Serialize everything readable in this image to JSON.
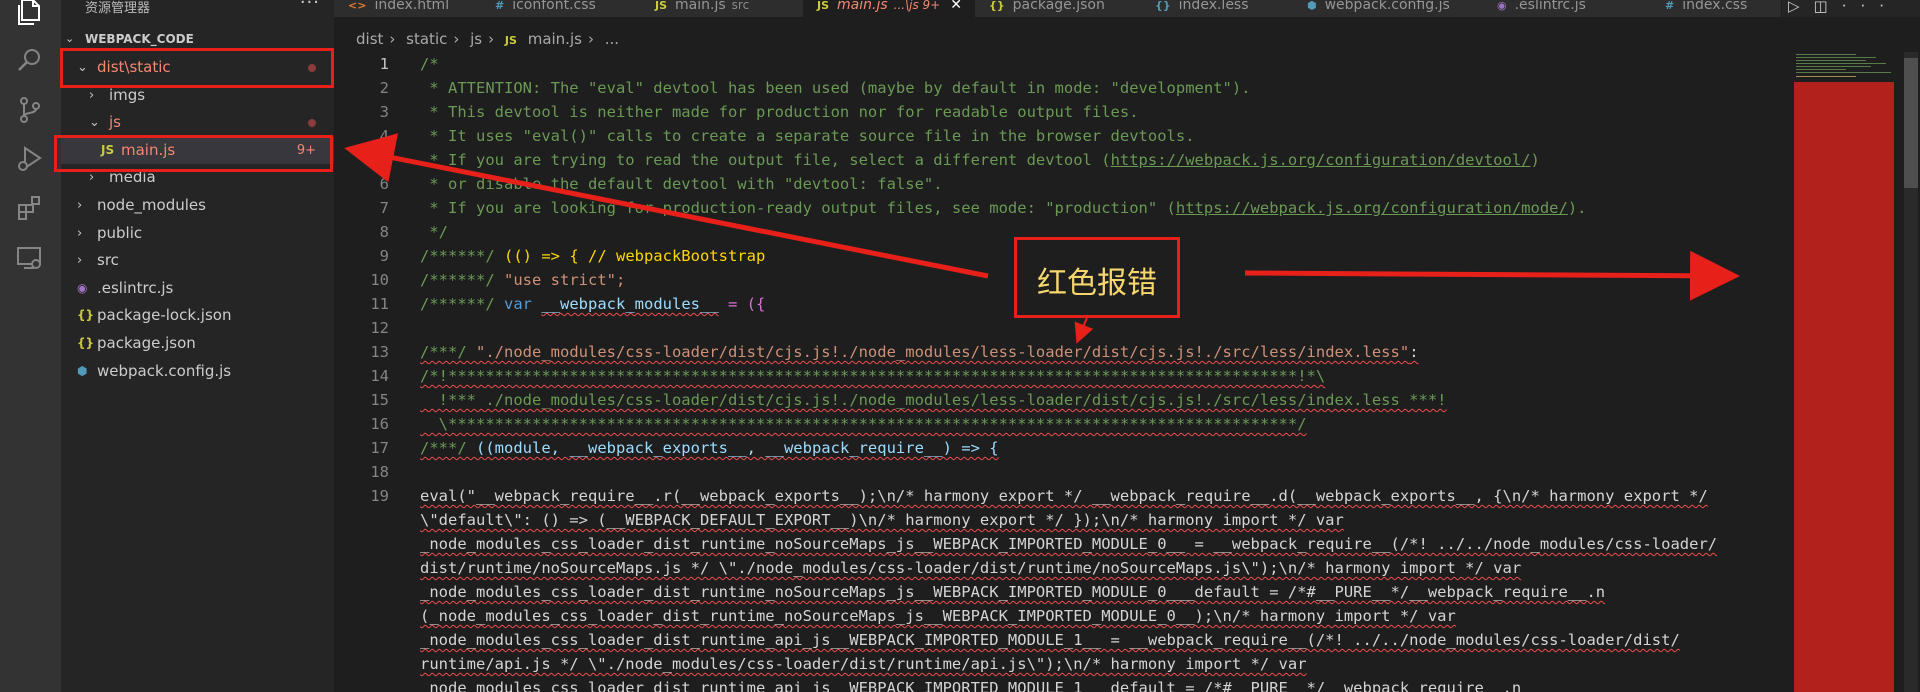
{
  "activity_bar": {
    "icons": [
      "explorer-icon",
      "search-icon",
      "source-control-icon",
      "run-debug-icon",
      "extensions-icon",
      "remote-explorer-icon"
    ]
  },
  "sidebar": {
    "title": "资源管理器",
    "more": "···",
    "section": "WEBPACK_CODE",
    "tree": [
      {
        "name": "dist\\static",
        "type": "folder",
        "expanded": true,
        "indent": 0,
        "dot": true
      },
      {
        "name": "imgs",
        "type": "folder",
        "expanded": false,
        "indent": 1
      },
      {
        "name": "js",
        "type": "folder",
        "expanded": true,
        "indent": 1,
        "dot": true
      },
      {
        "name": "main.js",
        "type": "js",
        "indent": 2,
        "badge": "9+",
        "selected": true
      },
      {
        "name": "media",
        "type": "folder",
        "expanded": false,
        "indent": 1
      },
      {
        "name": "node_modules",
        "type": "folder",
        "expanded": false,
        "indent": 0
      },
      {
        "name": "public",
        "type": "folder",
        "expanded": false,
        "indent": 0
      },
      {
        "name": "src",
        "type": "folder",
        "expanded": false,
        "indent": 0
      },
      {
        "name": ".eslintrc.js",
        "type": "eslint",
        "indent": 0
      },
      {
        "name": "package-lock.json",
        "type": "json",
        "indent": 0
      },
      {
        "name": "package.json",
        "type": "json",
        "indent": 0
      },
      {
        "name": "webpack.config.js",
        "type": "webpack",
        "indent": 0
      }
    ]
  },
  "tabs": [
    {
      "icon": "<>",
      "label": "index.html",
      "color": "#e37933"
    },
    {
      "icon": "#",
      "label": "iconfont.css",
      "color": "#519aba"
    },
    {
      "icon": "JS",
      "label": "main.js",
      "sub": "src",
      "color": "#cbcb41"
    },
    {
      "icon": "JS",
      "label": "main.js",
      "sub": "...\\js 9+",
      "color": "#cbcb41",
      "active": true
    },
    {
      "icon": "{}",
      "label": "package.json",
      "color": "#cbcb41"
    },
    {
      "icon": "{}",
      "label": "index.less",
      "color": "#519aba"
    },
    {
      "icon": "⬢",
      "label": "webpack.config.js",
      "color": "#519aba"
    },
    {
      "icon": "◉",
      "label": ".eslintrc.js",
      "color": "#a074c4"
    },
    {
      "icon": "#",
      "label": "index.css",
      "color": "#519aba"
    }
  ],
  "tab_actions": [
    "▷",
    "◫",
    "···"
  ],
  "breadcrumb": [
    "dist",
    "static",
    "js",
    "JS",
    "main.js",
    "..."
  ],
  "editor": {
    "line_numbers": [
      "1",
      "2",
      "3",
      "4",
      "5",
      "6",
      "7",
      "8",
      "9",
      "10",
      "11",
      "12",
      "13",
      "14",
      "15",
      "16",
      "17",
      "18",
      "19"
    ],
    "lines": [
      "/*",
      " * ATTENTION: The \"eval\" devtool has been used (maybe by default in mode: \"development\").",
      " * This devtool is neither made for production nor for readable output files.",
      " * It uses \"eval()\" calls to create a separate source file in the browser devtools.",
      " * If you are trying to read the output file, select a different devtool (",
      " * or disable the default devtool with \"devtool: false\".",
      " * If you are looking for production-ready output files, see mode: \"production\" (",
      " */",
      "/******/ ",
      "/******/ ",
      "/******/ ",
      "",
      "/***/ ",
      "/*!*******************************************************************************************!*\\",
      "  !*** ./node_modules/css-loader/dist/cjs.js!./node_modules/less-loader/dist/cjs.js!./src/less/index.less ***!",
      "  \\*******************************************************************************************/",
      "/***/ ",
      "",
      "eval(\"__webpack_require__.r(__webpack_exports__);\\n/* harmony export */ __webpack_require__.d(__webpack_exports__, {\\n/* harmony export */",
      "\\\"default\\\": () => (__WEBPACK_DEFAULT_EXPORT__)\\n/* harmony export */ });\\n/* harmony import */ var",
      "_node_modules_css_loader_dist_runtime_noSourceMaps_js__WEBPACK_IMPORTED_MODULE_0__ = __webpack_require__(/*! ../../node_modules/css-loader/",
      "dist/runtime/noSourceMaps.js */ \\\"./node_modules/css-loader/dist/runtime/noSourceMaps.js\\\");\\n/* harmony import */ var",
      "_node_modules_css_loader_dist_runtime_noSourceMaps_js__WEBPACK_IMPORTED_MODULE_0___default = /*#__PURE__*/__webpack_require__.n",
      "(_node_modules_css_loader_dist_runtime_noSourceMaps_js__WEBPACK_IMPORTED_MODULE_0__);\\n/* harmony import */ var",
      "_node_modules_css_loader_dist_runtime_api_js__WEBPACK_IMPORTED_MODULE_1__ = __webpack_require__(/*! ../../node_modules/css-loader/dist/",
      "runtime/api.js */ \\\"./node_modules/css-loader/dist/runtime/api.js\\\");\\n/* harmony import */ var",
      "_node_modules_css_loader_dist_runtime_api_js__WEBPACK_IMPORTED_MODULE_1___default = /*#__PURE__*/__webpack_require__.n"
    ],
    "links": [
      "https://webpack.js.org/configuration/devtool/",
      "https://webpack.js.org/configuration/mode/"
    ],
    "link_tails": [
      ")",
      ")."
    ],
    "line9_rest": "(() => { // webpackBootstrap",
    "line10_rest": "\"use strict\";",
    "line11_kw": "var",
    "line11_name": "__webpack_modules__",
    "line11_rest": " = ({",
    "line13_str": "\"./node_modules/css-loader/dist/cjs.js!./node_modules/less-loader/dist/cjs.js!./src/less/index.less\"",
    "line13_rest": ":",
    "line17_rest": "((module, __webpack_exports__, __webpack_require__) => {"
  },
  "annotation": {
    "callout": "红色报错"
  },
  "colors": {
    "error_red": "#e8201a",
    "callout_text": "#f5d76e"
  }
}
